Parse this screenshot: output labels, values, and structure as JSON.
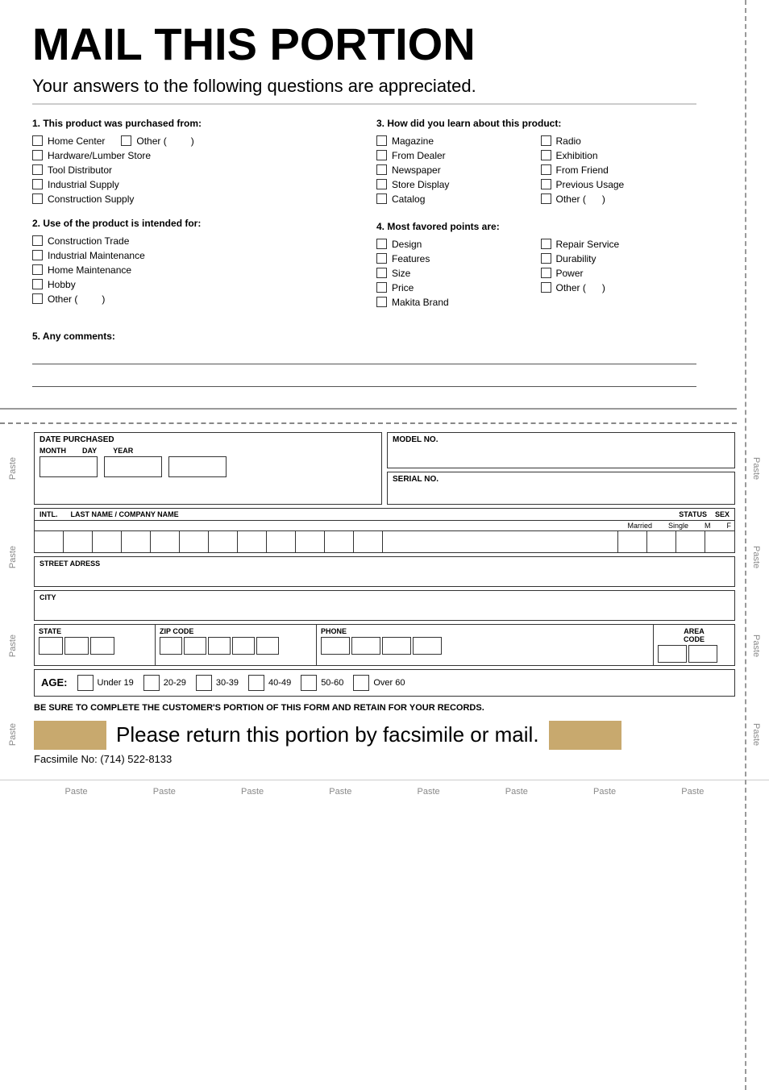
{
  "page": {
    "title": "MAIL THIS PORTION",
    "subtitle": "Your answers to the following questions are appreciated.",
    "sections": {
      "q1": {
        "title": "1. This product was purchased from:",
        "options": [
          "Home Center",
          "Other (",
          "Hardware/Lumber Store",
          "Tool Distributor",
          "Industrial Supply",
          "Construction Supply"
        ]
      },
      "q2": {
        "title": "2. Use of the product is intended for:",
        "options": [
          "Construction Trade",
          "Industrial Maintenance",
          "Home Maintenance",
          "Hobby",
          "Other ("
        ]
      },
      "q3": {
        "title": "3. How did you learn about this product:",
        "options_left": [
          "Magazine",
          "From Dealer",
          "Newspaper",
          "Store Display",
          "Catalog"
        ],
        "options_right": [
          "Radio",
          "Exhibition",
          "From Friend",
          "Previous Usage",
          "Other ("
        ]
      },
      "q4": {
        "title": "4. Most favored points are:",
        "options_left": [
          "Design",
          "Features",
          "Size",
          "Price",
          "Makita Brand"
        ],
        "options_right": [
          "Repair Service",
          "Durability",
          "Power",
          "Other ("
        ]
      },
      "q5": {
        "title": "5. Any comments:"
      }
    },
    "form": {
      "date_purchased_label": "DATE PURCHASED",
      "month_label": "MONTH",
      "day_label": "DAY",
      "year_label": "YEAR",
      "model_no_label": "MODEL NO.",
      "serial_no_label": "SERIAL NO.",
      "intl_label": "INTL.",
      "last_name_label": "LAST NAME / COMPANY NAME",
      "status_label": "STATUS",
      "sex_label": "SEX",
      "married_label": "Married",
      "single_label": "Single",
      "m_label": "M",
      "f_label": "F",
      "street_label": "STREET ADRESS",
      "city_label": "CITY",
      "state_label": "STATE",
      "zip_label": "ZIP CODE",
      "phone_label": "PHONE",
      "area_code_label": "AREA CODE",
      "age_label": "AGE:",
      "age_options": [
        "Under 19",
        "20-29",
        "30-39",
        "40-49",
        "50-60",
        "Over 60"
      ]
    },
    "footer": {
      "retain_text": "BE SURE TO COMPLETE THE CUSTOMER'S PORTION OF THIS FORM AND RETAIN FOR YOUR RECORDS.",
      "return_text": "Please return this portion by facsimile or mail.",
      "fax_text": "Facsimile No: (714) 522-8133"
    },
    "paste_labels": [
      "Paste",
      "Paste",
      "Paste",
      "Paste",
      "Paste",
      "Paste",
      "Paste",
      "Paste"
    ],
    "paste_side": "Paste"
  }
}
